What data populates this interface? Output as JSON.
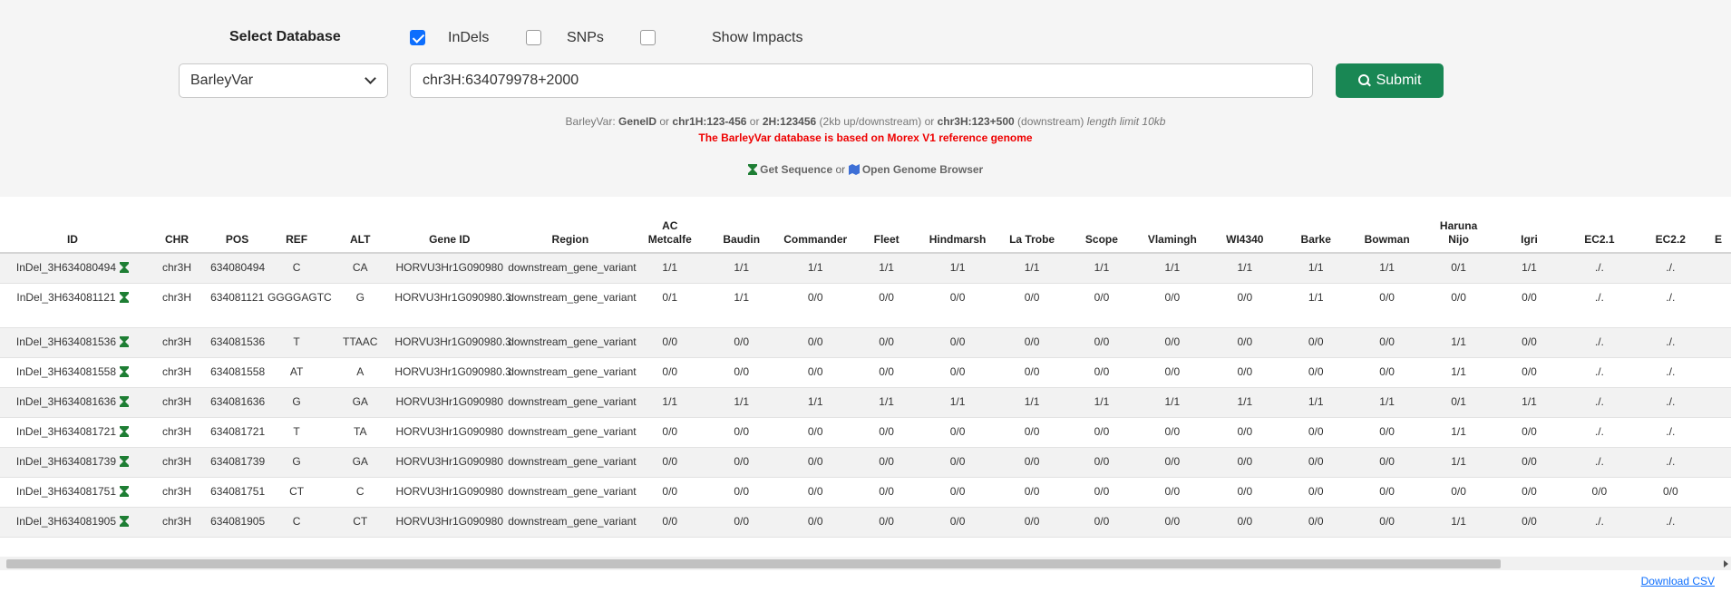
{
  "form": {
    "select_title": "Select Database",
    "options": [
      {
        "label": "InDels",
        "checked": true
      },
      {
        "label": "SNPs",
        "checked": false
      },
      {
        "label": "Show Impacts",
        "checked": false
      }
    ],
    "database_value": "BarleyVar",
    "query_value": "chr3H:634079978+2000",
    "submit_label": "Submit"
  },
  "help": {
    "db": "BarleyVar:",
    "t1": "GeneID",
    "or1": "or",
    "t2": "chr1H:123-456",
    "or2": "or",
    "t3": "2H:123456",
    "t3_note": "(2kb up/downstream)",
    "or3": "or",
    "t4": "chr3H:123+500",
    "t4_note": "(downstream)",
    "limit": "length limit 10kb",
    "warning": "The BarleyVar database is based on Morex V1 reference genome",
    "get_sequence": "Get Sequence",
    "or_word": "or",
    "genome_browser": "Open Genome Browser"
  },
  "table": {
    "columns": [
      {
        "l1": "",
        "l2": "ID"
      },
      {
        "l1": "",
        "l2": "CHR"
      },
      {
        "l1": "",
        "l2": "POS"
      },
      {
        "l1": "",
        "l2": "REF"
      },
      {
        "l1": "",
        "l2": "ALT"
      },
      {
        "l1": "",
        "l2": "Gene ID"
      },
      {
        "l1": "",
        "l2": "Region"
      },
      {
        "l1": "AC",
        "l2": "Metcalfe"
      },
      {
        "l1": "",
        "l2": "Baudin"
      },
      {
        "l1": "",
        "l2": "Commander"
      },
      {
        "l1": "",
        "l2": "Fleet"
      },
      {
        "l1": "",
        "l2": "Hindmarsh"
      },
      {
        "l1": "",
        "l2": "La Trobe"
      },
      {
        "l1": "",
        "l2": "Scope"
      },
      {
        "l1": "",
        "l2": "Vlamingh"
      },
      {
        "l1": "",
        "l2": "WI4340"
      },
      {
        "l1": "",
        "l2": "Barke"
      },
      {
        "l1": "",
        "l2": "Bowman"
      },
      {
        "l1": "Haruna",
        "l2": "Nijo"
      },
      {
        "l1": "",
        "l2": "Igri"
      },
      {
        "l1": "",
        "l2": "EC2.1"
      },
      {
        "l1": "",
        "l2": "EC2.2"
      },
      {
        "l1": "",
        "l2": "E"
      }
    ],
    "rows": [
      [
        "InDel_3H634080494",
        "chr3H",
        "634080494",
        "C",
        "CA",
        "HORVU3Hr1G090980",
        "downstream_gene_variant",
        "1/1",
        "1/1",
        "1/1",
        "1/1",
        "1/1",
        "1/1",
        "1/1",
        "1/1",
        "1/1",
        "1/1",
        "1/1",
        "0/1",
        "1/1",
        "./.",
        "./.",
        ""
      ],
      [
        "InDel_3H634081121",
        "chr3H",
        "634081121",
        "GGGGAGTC",
        "G",
        "HORVU3Hr1G090980.3",
        "downstream_gene_variant",
        "0/1",
        "1/1",
        "0/0",
        "0/0",
        "0/0",
        "0/0",
        "0/0",
        "0/0",
        "0/0",
        "1/1",
        "0/0",
        "0/0",
        "0/0",
        "./.",
        "./.",
        ""
      ],
      [
        "InDel_3H634081536",
        "chr3H",
        "634081536",
        "T",
        "TTAAC",
        "HORVU3Hr1G090980.3",
        "downstream_gene_variant",
        "0/0",
        "0/0",
        "0/0",
        "0/0",
        "0/0",
        "0/0",
        "0/0",
        "0/0",
        "0/0",
        "0/0",
        "0/0",
        "1/1",
        "0/0",
        "./.",
        "./.",
        ""
      ],
      [
        "InDel_3H634081558",
        "chr3H",
        "634081558",
        "AT",
        "A",
        "HORVU3Hr1G090980.3",
        "downstream_gene_variant",
        "0/0",
        "0/0",
        "0/0",
        "0/0",
        "0/0",
        "0/0",
        "0/0",
        "0/0",
        "0/0",
        "0/0",
        "0/0",
        "1/1",
        "0/0",
        "./.",
        "./.",
        ""
      ],
      [
        "InDel_3H634081636",
        "chr3H",
        "634081636",
        "G",
        "GA",
        "HORVU3Hr1G090980",
        "downstream_gene_variant",
        "1/1",
        "1/1",
        "1/1",
        "1/1",
        "1/1",
        "1/1",
        "1/1",
        "1/1",
        "1/1",
        "1/1",
        "1/1",
        "0/1",
        "1/1",
        "./.",
        "./.",
        ""
      ],
      [
        "InDel_3H634081721",
        "chr3H",
        "634081721",
        "T",
        "TA",
        "HORVU3Hr1G090980",
        "downstream_gene_variant",
        "0/0",
        "0/0",
        "0/0",
        "0/0",
        "0/0",
        "0/0",
        "0/0",
        "0/0",
        "0/0",
        "0/0",
        "0/0",
        "1/1",
        "0/0",
        "./.",
        "./.",
        ""
      ],
      [
        "InDel_3H634081739",
        "chr3H",
        "634081739",
        "G",
        "GA",
        "HORVU3Hr1G090980",
        "downstream_gene_variant",
        "0/0",
        "0/0",
        "0/0",
        "0/0",
        "0/0",
        "0/0",
        "0/0",
        "0/0",
        "0/0",
        "0/0",
        "0/0",
        "1/1",
        "0/0",
        "./.",
        "./.",
        ""
      ],
      [
        "InDel_3H634081751",
        "chr3H",
        "634081751",
        "CT",
        "C",
        "HORVU3Hr1G090980",
        "downstream_gene_variant",
        "0/0",
        "0/0",
        "0/0",
        "0/0",
        "0/0",
        "0/0",
        "0/0",
        "0/0",
        "0/0",
        "0/0",
        "0/0",
        "0/0",
        "0/0",
        "0/0",
        "0/0",
        ""
      ],
      [
        "InDel_3H634081905",
        "chr3H",
        "634081905",
        "C",
        "CT",
        "HORVU3Hr1G090980",
        "downstream_gene_variant",
        "0/0",
        "0/0",
        "0/0",
        "0/0",
        "0/0",
        "0/0",
        "0/0",
        "0/0",
        "0/0",
        "0/0",
        "0/0",
        "1/1",
        "0/0",
        "./.",
        "./.",
        ""
      ]
    ]
  },
  "download_csv": "Download CSV",
  "colors": {
    "checkbox_checked": "#0d6efd",
    "submit_bg": "#198754",
    "warning_text": "#ee0000",
    "sequence_icon": "#1e7e34",
    "map_icon": "#3d6fd6"
  },
  "icons": {
    "search": "search-icon",
    "sequence": "hourglass-icon",
    "browser": "map-icon",
    "dropdown": "chevron-down-icon"
  }
}
